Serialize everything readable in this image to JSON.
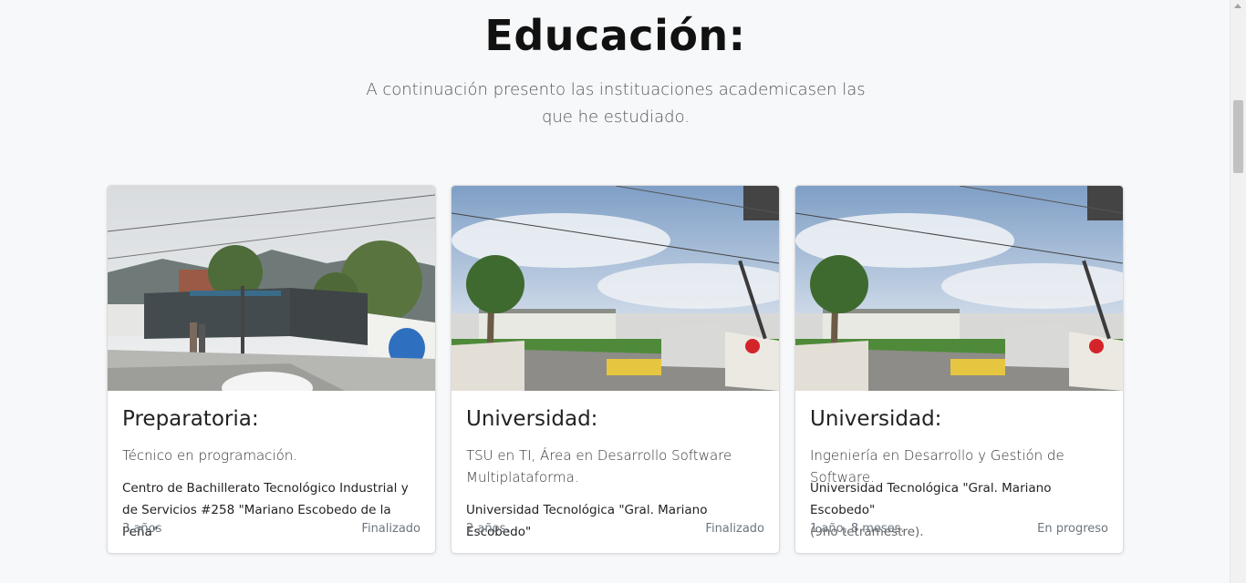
{
  "section": {
    "title": "Educación:",
    "subtitle": "A continuación presento las instituaciones academicasen las que he estudiado."
  },
  "cards": [
    {
      "image": "school-entrance-photo",
      "title": "Preparatoria:",
      "text": "Técnico en programación.",
      "institution": "Centro de Bachillerato Tecnológico Industrial y de Servicios #258 \"Mariano Escobedo de la Peña\"",
      "institution_note": "",
      "duration": "3 años",
      "status": "Finalizado"
    },
    {
      "image": "university-gate-photo",
      "title": "Universidad:",
      "text": "TSU en TI, Área en Desarrollo Software Multiplataforma.",
      "institution": "Universidad Tecnológica \"Gral. Mariano Escobedo\"",
      "institution_note": "",
      "duration": "2 años.",
      "status": "Finalizado"
    },
    {
      "image": "university-gate-photo",
      "title": "Universidad:",
      "text": "Ingeniería en Desarrollo y Gestión de Software.",
      "institution": "Universidad Tecnológica \"Gral. Mariano Escobedo\"",
      "institution_note": "(9no tetramestre).",
      "duration": "1 año, 8 meses.",
      "status": "En progreso"
    }
  ]
}
